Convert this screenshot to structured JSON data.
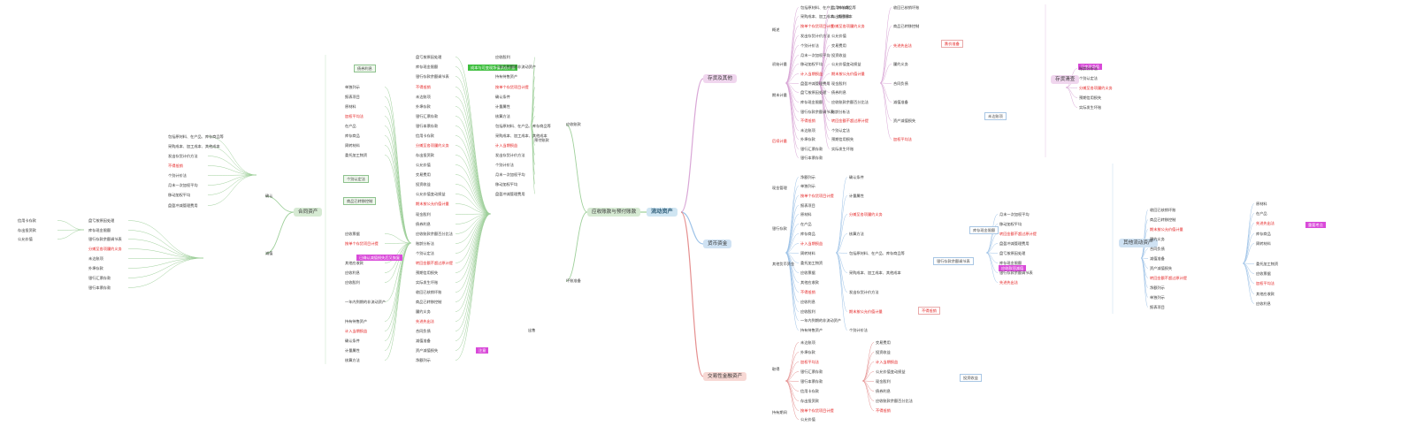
{
  "root": {
    "label": "流动资产"
  },
  "main": [
    {
      "label": "存货及其他"
    },
    {
      "label": "货币资金"
    },
    {
      "label": "交易性金融资产"
    },
    {
      "label": "应收账款与预付账款"
    },
    {
      "label": "合同资产"
    }
  ],
  "subs": [
    {
      "label": "概述"
    },
    {
      "label": "初始计量"
    },
    {
      "label": "期末计量"
    },
    {
      "label": "后续计量"
    },
    {
      "label": "存货清查"
    },
    {
      "label": "其他流动资产"
    },
    {
      "label": "现金管理"
    },
    {
      "label": "银行存款"
    },
    {
      "label": "其他货币资金"
    },
    {
      "label": "取得"
    },
    {
      "label": "持有期间"
    },
    {
      "label": "出售"
    },
    {
      "label": "应收账款"
    },
    {
      "label": "坏账准备"
    },
    {
      "label": "预付账款"
    },
    {
      "label": "确认"
    },
    {
      "label": "减值"
    }
  ],
  "detail": {
    "highlights": [
      {
        "label": "可变现净值"
      },
      {
        "label": "跌价准备"
      },
      {
        "label": "注意"
      },
      {
        "label": "成本与可变现净值孰低计量"
      },
      {
        "label": "重要考点"
      },
      {
        "label": "应收款项减值"
      },
      {
        "label": "已确认减值损失后又恢复"
      }
    ],
    "red_notes": [
      {
        "label": "按单个存货项目计提"
      },
      {
        "label": "计入当期损益"
      },
      {
        "label": "不得抵销"
      },
      {
        "label": "分摊至各项履约义务"
      },
      {
        "label": "期末按公允价值计量"
      },
      {
        "label": "转回金额不超过原计提"
      },
      {
        "label": "先进先出法"
      },
      {
        "label": "加权平均法"
      }
    ],
    "notes": [
      {
        "label": "包括原材料、在产品、库存商品等"
      },
      {
        "label": "采购成本、加工成本、其他成本"
      },
      {
        "label": "发出存货计价方法"
      },
      {
        "label": "个别计价法"
      },
      {
        "label": "月末一次加权平均"
      },
      {
        "label": "移动加权平均"
      },
      {
        "label": "盘盈冲减管理费用"
      },
      {
        "label": "盘亏按原因处理"
      },
      {
        "label": "库存现金限额"
      },
      {
        "label": "银行存款余额调节表"
      },
      {
        "label": "未达账项"
      },
      {
        "label": "外埠存款"
      },
      {
        "label": "银行汇票存款"
      },
      {
        "label": "银行本票存款"
      },
      {
        "label": "信用卡存款"
      },
      {
        "label": "存出投资款"
      },
      {
        "label": "公允价值"
      },
      {
        "label": "交易费用"
      },
      {
        "label": "投资收益"
      },
      {
        "label": "公允价值变动损益"
      },
      {
        "label": "现金股利"
      },
      {
        "label": "债券利息"
      },
      {
        "label": "应收账款余额百分比法"
      },
      {
        "label": "账龄分析法"
      },
      {
        "label": "个别认定法"
      },
      {
        "label": "预期信用损失"
      },
      {
        "label": "实际发生坏账"
      },
      {
        "label": "收回已核销坏账"
      },
      {
        "label": "商品已转移控制"
      },
      {
        "label": "履约义务"
      },
      {
        "label": "合同负债"
      },
      {
        "label": "减值准备"
      },
      {
        "label": "资产减值损失"
      },
      {
        "label": "净额列示"
      },
      {
        "label": "单独列示"
      },
      {
        "label": "报表项目"
      },
      {
        "label": "原材料"
      },
      {
        "label": "在产品"
      },
      {
        "label": "库存商品"
      },
      {
        "label": "周转材料"
      },
      {
        "label": "委托加工物资"
      },
      {
        "label": "应收票据"
      },
      {
        "label": "其他应收款"
      },
      {
        "label": "应收利息"
      },
      {
        "label": "应收股利"
      },
      {
        "label": "一年内到期的非流动资产"
      },
      {
        "label": "持有待售资产"
      },
      {
        "label": "确认条件"
      },
      {
        "label": "计量属性"
      },
      {
        "label": "核算方法"
      }
    ]
  },
  "colors": {
    "root_bg": "#cfe5f2",
    "red_branch": "#e58f8f",
    "pink_branch": "#d9a6d6",
    "blue_branch": "#9ec3e8",
    "green_branch": "#9fd09b",
    "highlight_magenta": "#d94ad9",
    "highlight_green": "#3fbf3f",
    "note_red": "#e31b1b"
  }
}
